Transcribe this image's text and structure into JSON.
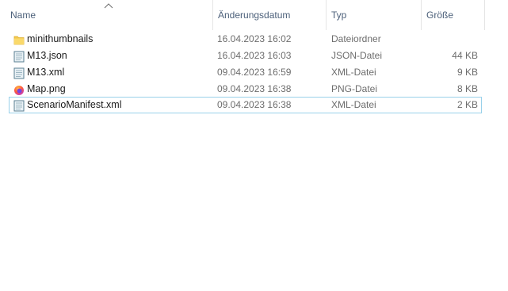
{
  "columns": {
    "name": "Name",
    "date": "Änderungsdatum",
    "type": "Typ",
    "size": "Größe"
  },
  "sort": {
    "column": "name",
    "direction": "ascending"
  },
  "files": [
    {
      "name": "minithumbnails",
      "date": "16.04.2023 16:02",
      "type": "Dateiordner",
      "size": "",
      "icon": "folder-icon"
    },
    {
      "name": "M13.json",
      "date": "16.04.2023 16:03",
      "type": "JSON-Datei",
      "size": "44 KB",
      "icon": "document-icon"
    },
    {
      "name": "M13.xml",
      "date": "09.04.2023 16:59",
      "type": "XML-Datei",
      "size": "9 KB",
      "icon": "document-icon"
    },
    {
      "name": "Map.png",
      "date": "09.04.2023 16:38",
      "type": "PNG-Datei",
      "size": "8 KB",
      "icon": "firefox-icon"
    },
    {
      "name": "ScenarioManifest.xml",
      "date": "09.04.2023 16:38",
      "type": "XML-Datei",
      "size": "2 KB",
      "icon": "document-icon"
    }
  ],
  "selected_index": 4,
  "colors": {
    "header_text": "#4c607a",
    "secondary_text": "#6d6d6d",
    "selection_border": "#99d1ea",
    "folder": "#f4c94e"
  }
}
